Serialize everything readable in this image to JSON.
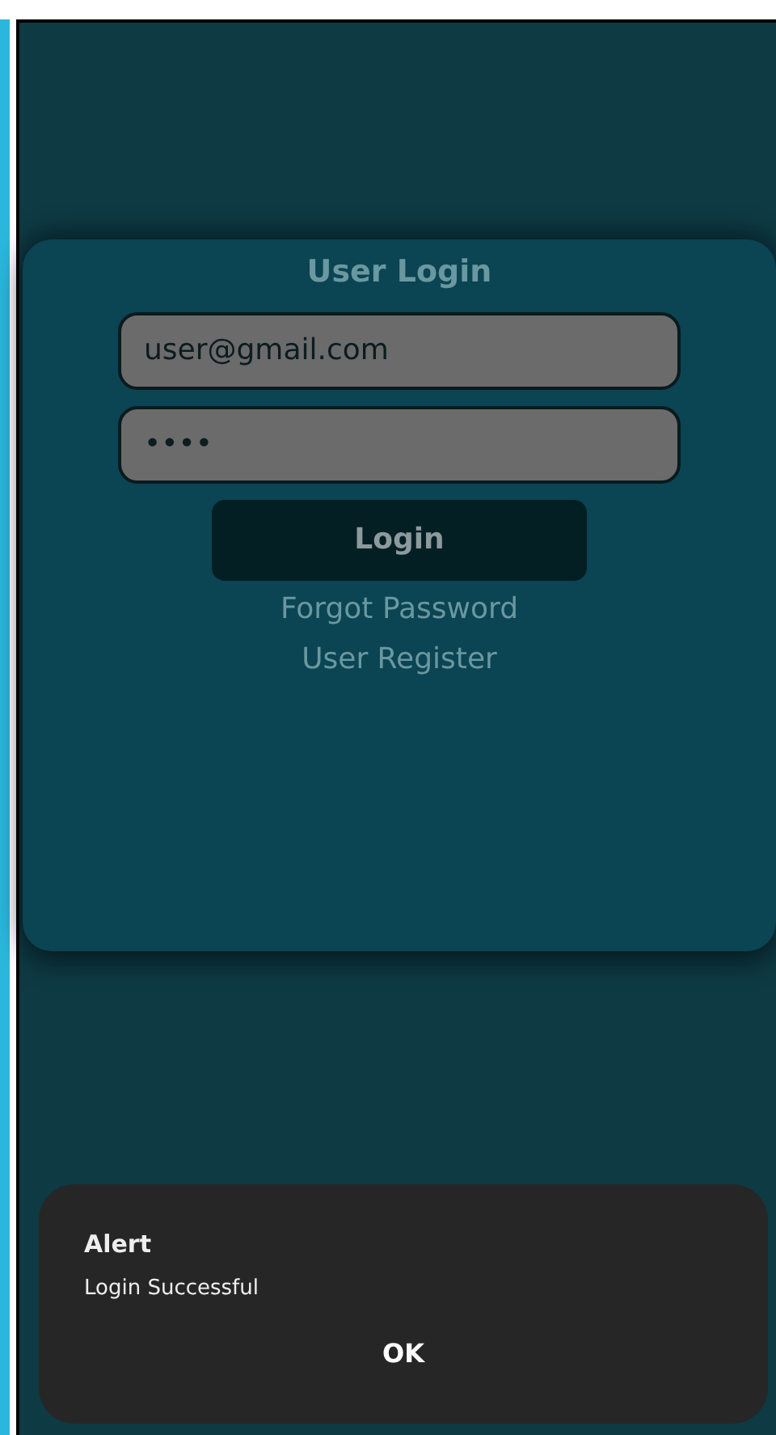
{
  "login_card": {
    "title": "User Login",
    "email_field": {
      "value": "user@gmail.com"
    },
    "password_field": {
      "value": "••••"
    },
    "login_button": "Login",
    "links": [
      "Forgot Password",
      "User Register"
    ]
  },
  "alert_dialog": {
    "title": "Alert",
    "message": "Login Successful",
    "button": "OK"
  }
}
